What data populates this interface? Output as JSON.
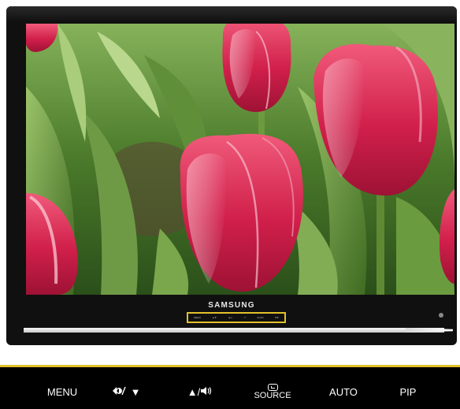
{
  "monitor": {
    "brand": "SAMSUNG",
    "mini_controls": [
      "MENU",
      "▲▼",
      "▲/◐",
      "⏎",
      "AUTO",
      "PIP"
    ]
  },
  "control_bar": {
    "buttons": [
      {
        "label": "MENU"
      },
      {
        "label": "▼",
        "icon": "brightness-contrast-icon"
      },
      {
        "label": "▲/",
        "icon": "volume-speaker-icon"
      },
      {
        "label": "SOURCE",
        "icon": "source-enter-icon"
      },
      {
        "label": "AUTO"
      },
      {
        "label": "PIP"
      }
    ]
  },
  "colors": {
    "accent": "#e2c12c",
    "bezel": "#101010",
    "bar": "#000000",
    "tulip": "#d6234a",
    "leaf": "#4f7a2e"
  }
}
